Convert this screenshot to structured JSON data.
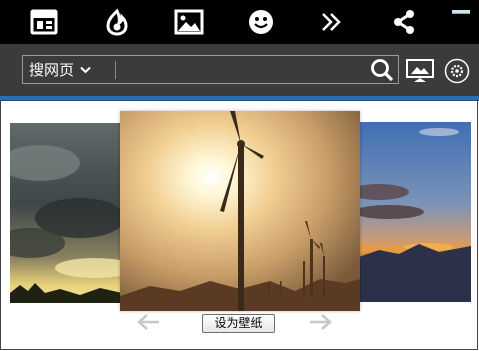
{
  "toolbar": {
    "icons": [
      "layout-icon",
      "flame-icon",
      "image-icon",
      "smiley-icon",
      "double-chevron-icon",
      "share-icon"
    ]
  },
  "search": {
    "engine_label": "搜网页",
    "placeholder": "",
    "value": ""
  },
  "gallery": {
    "set_wallpaper_label": "设为壁纸"
  },
  "colors": {
    "top_bar": "#000000",
    "search_bar": "#3b3b3b",
    "accent_blue": "#2a6fb0"
  }
}
